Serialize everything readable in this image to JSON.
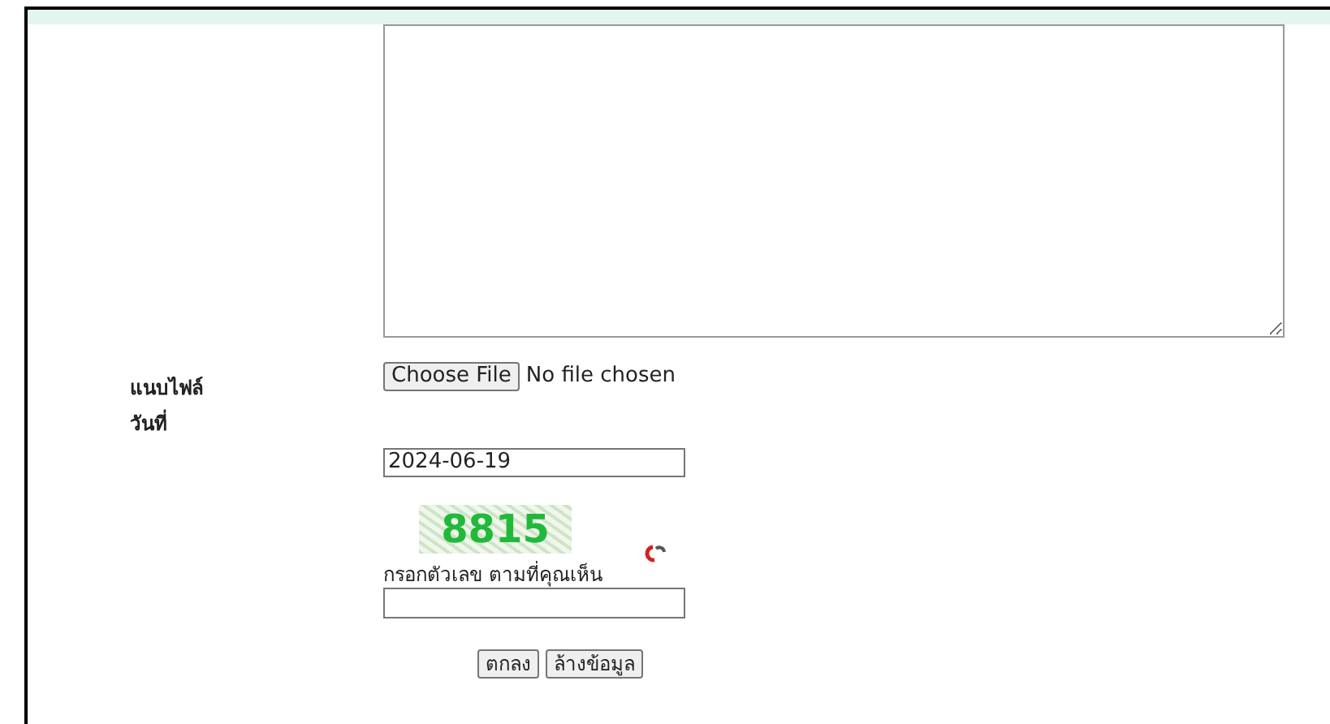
{
  "attachment": {
    "label": "แนบไฟล์",
    "button": "Choose File",
    "status": "No file chosen"
  },
  "date": {
    "label": "วันที่",
    "value": "2024-06-19"
  },
  "captcha": {
    "code": "8815",
    "instruction": "กรอกตัวเลข ตามที่คุณเห็น"
  },
  "buttons": [
    "ตกลง",
    "ล้างข้อมูล"
  ]
}
